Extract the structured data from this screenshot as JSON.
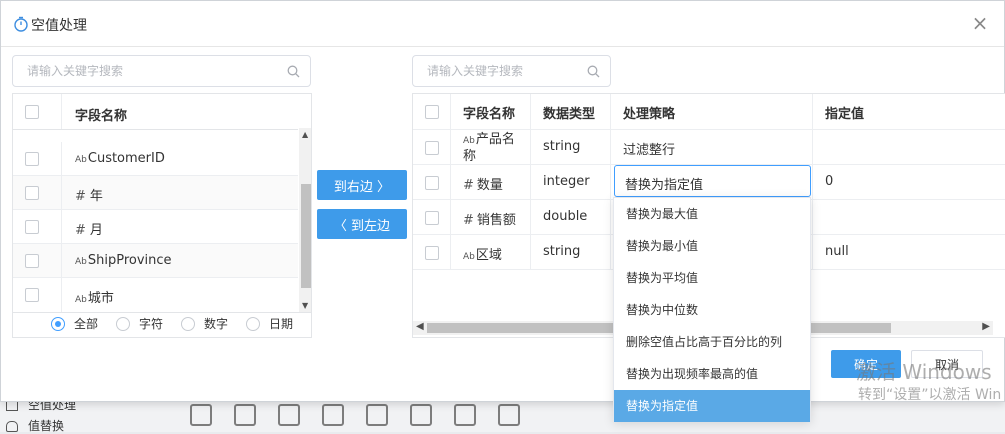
{
  "background": {
    "left_items": [
      "空值处理",
      "值替换"
    ]
  },
  "dialog": {
    "title": "空值处理",
    "left": {
      "search_placeholder": "请输入关键字搜索",
      "header": "字段名称",
      "rows": [
        {
          "type": "Ab",
          "name": "CustomerID"
        },
        {
          "type": "#",
          "name": "年"
        },
        {
          "type": "#",
          "name": "月"
        },
        {
          "type": "Ab",
          "name": "ShipProvince"
        },
        {
          "type": "Ab",
          "name": "城市"
        }
      ],
      "filters": [
        {
          "label": "全部",
          "checked": true
        },
        {
          "label": "字符",
          "checked": false
        },
        {
          "label": "数字",
          "checked": false
        },
        {
          "label": "日期",
          "checked": false
        }
      ]
    },
    "transfer": {
      "to_right": "到右边 〉",
      "to_left": "〈 到左边"
    },
    "right": {
      "search_placeholder": "请输入关键字搜索",
      "headers": {
        "field": "字段名称",
        "dtype": "数据类型",
        "strategy": "处理策略",
        "value": "指定值"
      },
      "rows": [
        {
          "type": "Ab",
          "name_line1": "产品名",
          "name_line2": "称",
          "dtype": "string",
          "strategy": "过滤整行",
          "value": ""
        },
        {
          "type": "#",
          "name_line1": "数量",
          "name_line2": "",
          "dtype": "integer",
          "strategy": "替换为指定值",
          "value": "0"
        },
        {
          "type": "#",
          "name_line1": "销售额",
          "name_line2": "",
          "dtype": "double",
          "strategy": "",
          "value": ""
        },
        {
          "type": "Ab",
          "name_line1": "区域",
          "name_line2": "",
          "dtype": "string",
          "strategy": "",
          "value": "null"
        }
      ]
    },
    "dropdown": {
      "options": [
        "替换为最大值",
        "替换为最小值",
        "替换为平均值",
        "替换为中位数",
        "删除空值占比高于百分比的列",
        "替换为出现频率最高的值",
        "替换为指定值"
      ],
      "selected_index": 6
    },
    "ok": "确定",
    "cancel": "取消"
  },
  "watermark": {
    "line1": "激活 Windows",
    "line2": "转到“设置”以激活 Win"
  },
  "colors": {
    "accent": "#3e9bea",
    "selected_option": "#5aa9e6"
  }
}
